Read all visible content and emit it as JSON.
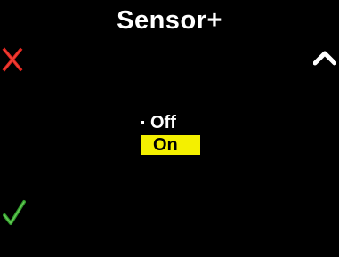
{
  "screen": {
    "title": "Sensor+",
    "background_color": "#000000"
  },
  "controls": {
    "cancel": {
      "icon": "x-icon",
      "color": "#e0261f"
    },
    "up": {
      "icon": "chevron-up-icon",
      "color": "#ffffff"
    },
    "confirm": {
      "icon": "checkmark-icon",
      "color": "#4cbb3c"
    }
  },
  "menu": {
    "options": [
      {
        "label": "Off",
        "current": true,
        "highlighted": false
      },
      {
        "label": "On",
        "current": false,
        "highlighted": true
      }
    ],
    "highlight_color": "#f4f000"
  }
}
